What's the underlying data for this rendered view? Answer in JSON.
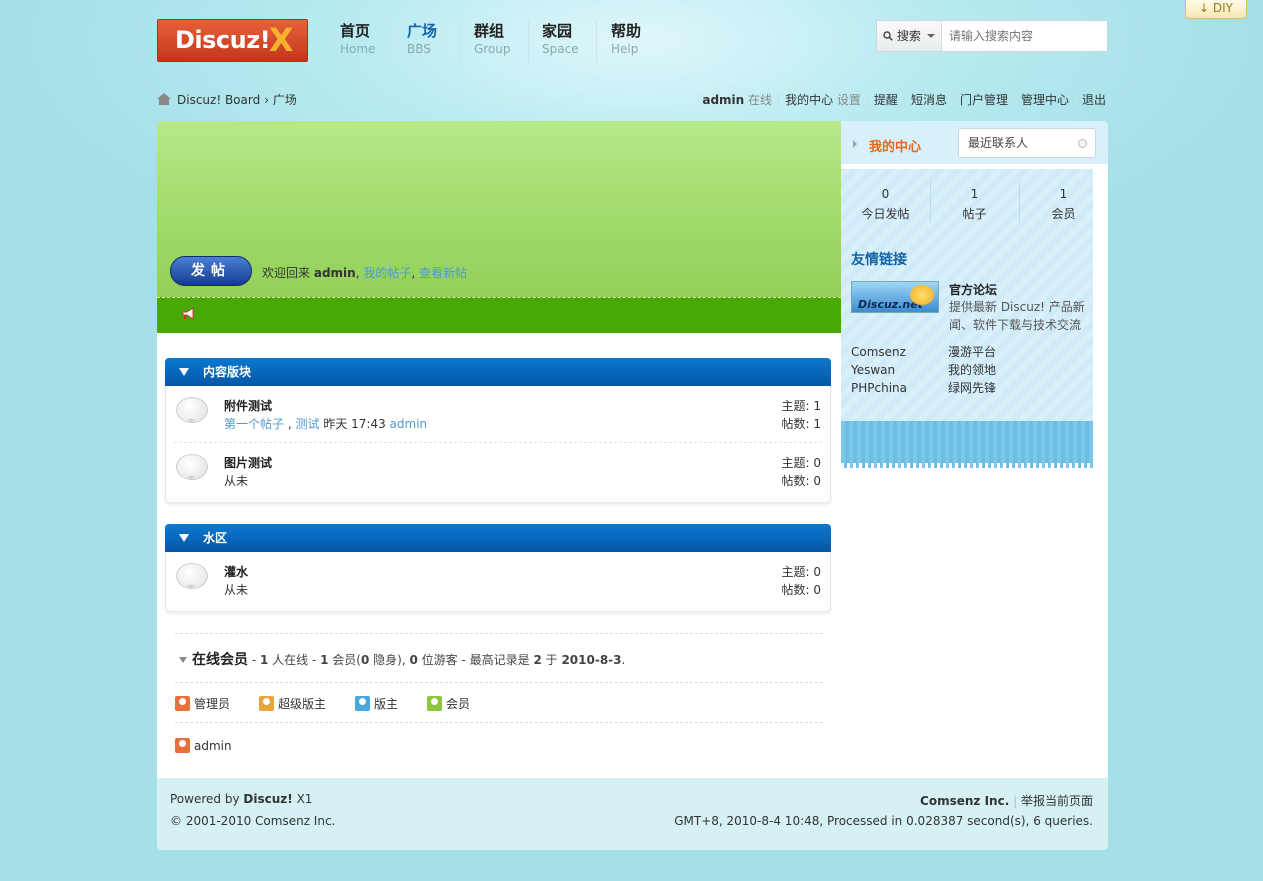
{
  "diy_label": "DIY",
  "logo": {
    "text": "Discuz!",
    "mark": "X"
  },
  "nav": [
    {
      "zh": "首页",
      "en": "Home"
    },
    {
      "zh": "广场",
      "en": "BBS"
    },
    {
      "zh": "群组",
      "en": "Group"
    },
    {
      "zh": "家园",
      "en": "Space"
    },
    {
      "zh": "帮助",
      "en": "Help"
    }
  ],
  "search": {
    "type": "搜索",
    "placeholder": "请输入搜索内容"
  },
  "breadcrumb": {
    "site": "Discuz! Board",
    "sep": "›",
    "current": "广场"
  },
  "user_menu": {
    "username": "admin",
    "status": "在线",
    "center": "我的中心",
    "settings": "设置",
    "remind": "提醒",
    "pm": "短消息",
    "portal_admin": "门户管理",
    "admin_center": "管理中心",
    "logout": "退出"
  },
  "post_button": "发帖",
  "welcome": {
    "prefix": "欢迎回来",
    "user": "admin",
    "my_posts": "我的帖子",
    "new_posts": "查看新帖"
  },
  "sidebar": {
    "title": "我的中心",
    "recent_contacts": "最近联系人",
    "stats": [
      {
        "value": "0",
        "label": "今日发帖"
      },
      {
        "value": "1",
        "label": "帖子"
      },
      {
        "value": "1",
        "label": "会员"
      }
    ],
    "friend_links_title": "友情链接",
    "official": {
      "logo_text": "Discuz.net",
      "title": "官方论坛",
      "desc": "提供最新 Discuz! 产品新闻、软件下载与技术交流"
    },
    "links": [
      {
        "name": "Comsenz",
        "desc": "漫游平台"
      },
      {
        "name": "Yeswan",
        "desc": "我的领地"
      },
      {
        "name": "PHPchina",
        "desc": "绿网先锋"
      }
    ]
  },
  "categories": [
    {
      "title": "内容版块",
      "forums": [
        {
          "name": "附件测试",
          "last_thread": "第一个帖子",
          "last_forum": "测试",
          "last_time": "昨天 17:43",
          "last_user": "admin",
          "topics": "主题: 1",
          "posts": "帖数: 1"
        },
        {
          "name": "图片测试",
          "never": "从未",
          "topics": "主题: 0",
          "posts": "帖数: 0"
        }
      ]
    },
    {
      "title": "水区",
      "forums": [
        {
          "name": "灌水",
          "never": "从未",
          "topics": "主题: 0",
          "posts": "帖数: 0"
        }
      ]
    }
  ],
  "online": {
    "title": "在线会员",
    "t1": "- ",
    "n1": "1",
    "t2": " 人在线 - ",
    "n2": "1",
    "t3": " 会员(",
    "n3": "0",
    "t4": " 隐身), ",
    "n4": "0",
    "t5": " 位游客 - 最高记录是 ",
    "n5": "2",
    "t6": " 于 ",
    "n6": "2010-8-3",
    "t7": "."
  },
  "legend": [
    {
      "label": "管理员",
      "color": "#e8703a"
    },
    {
      "label": "超级版主",
      "color": "#e8a53a"
    },
    {
      "label": "版主",
      "color": "#4aa7de"
    },
    {
      "label": "会员",
      "color": "#8cc63e"
    }
  ],
  "online_users": [
    "admin"
  ],
  "footer": {
    "powered_prefix": "Powered by",
    "product": "Discuz!",
    "version": "X1",
    "copyright": "© 2001-2010 Comsenz Inc.",
    "company": "Comsenz Inc.",
    "report": "举报当前页面",
    "stats": "GMT+8, 2010-8-4 10:48, Processed in 0.028387 second(s), 6 queries."
  }
}
